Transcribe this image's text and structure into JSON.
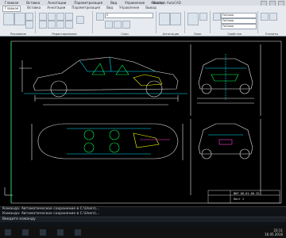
{
  "window": {
    "caption": "Autodesk AutoCAD",
    "menu": [
      "Главная",
      "Вставка",
      "Аннотации",
      "Параметризация",
      "Вид",
      "Управление",
      "Вывод"
    ]
  },
  "ribbon": {
    "tabs": [
      "Главная",
      "Вставка",
      "Аннотации",
      "Параметризация",
      "Вид",
      "Управление",
      "Вывод"
    ],
    "panels": [
      "Рисование",
      "Редактирование",
      "Слои",
      "Аннотации",
      "Блок",
      "Свойства",
      "Утилиты",
      "Буфер обмена"
    ],
    "layer_combo": "0",
    "style_combo": "ПоСлою",
    "linetype_combo": "ПоСлою"
  },
  "drawing": {
    "title_code": "ВКР 00.01.00 СБ",
    "sheet": "Лист 1"
  },
  "command_line": {
    "history_1": "Команда: Автоматическое сохранение в C:\\Users\\...",
    "history_2": "Команда: Автоматическое сохранение в C:\\Users\\...",
    "prompt": "Введите команду"
  },
  "taskbar": {
    "time": "23:11",
    "date": "16.05.2016",
    "lang": "РУС"
  },
  "colors": {
    "canvas": "#000000",
    "ribbon": "#e7ebf0",
    "line_white": "#e6e6e6",
    "line_cyan": "#00e5ff",
    "line_green": "#00ff55",
    "line_yellow": "#ffff00",
    "line_magenta": "#ff3bd4"
  }
}
